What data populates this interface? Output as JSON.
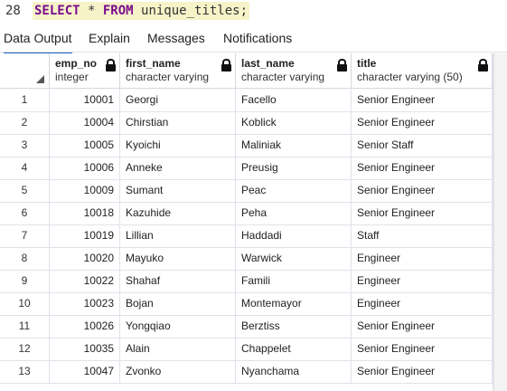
{
  "editor": {
    "line_number": "28",
    "kw_select": "SELECT",
    "star": " * ",
    "kw_from": "FROM",
    "rest": " unique_titles;"
  },
  "tabs": [
    {
      "label": "Data Output",
      "active": true
    },
    {
      "label": "Explain",
      "active": false
    },
    {
      "label": "Messages",
      "active": false
    },
    {
      "label": "Notifications",
      "active": false
    }
  ],
  "columns": [
    {
      "name": "emp_no",
      "type": "integer"
    },
    {
      "name": "first_name",
      "type": "character varying"
    },
    {
      "name": "last_name",
      "type": "character varying"
    },
    {
      "name": "title",
      "type": "character varying (50)"
    }
  ],
  "rows": [
    {
      "idx": "1",
      "emp_no": "10001",
      "first_name": "Georgi",
      "last_name": "Facello",
      "title": "Senior Engineer"
    },
    {
      "idx": "2",
      "emp_no": "10004",
      "first_name": "Chirstian",
      "last_name": "Koblick",
      "title": "Senior Engineer"
    },
    {
      "idx": "3",
      "emp_no": "10005",
      "first_name": "Kyoichi",
      "last_name": "Maliniak",
      "title": "Senior Staff"
    },
    {
      "idx": "4",
      "emp_no": "10006",
      "first_name": "Anneke",
      "last_name": "Preusig",
      "title": "Senior Engineer"
    },
    {
      "idx": "5",
      "emp_no": "10009",
      "first_name": "Sumant",
      "last_name": "Peac",
      "title": "Senior Engineer"
    },
    {
      "idx": "6",
      "emp_no": "10018",
      "first_name": "Kazuhide",
      "last_name": "Peha",
      "title": "Senior Engineer"
    },
    {
      "idx": "7",
      "emp_no": "10019",
      "first_name": "Lillian",
      "last_name": "Haddadi",
      "title": "Staff"
    },
    {
      "idx": "8",
      "emp_no": "10020",
      "first_name": "Mayuko",
      "last_name": "Warwick",
      "title": "Engineer"
    },
    {
      "idx": "9",
      "emp_no": "10022",
      "first_name": "Shahaf",
      "last_name": "Famili",
      "title": "Engineer"
    },
    {
      "idx": "10",
      "emp_no": "10023",
      "first_name": "Bojan",
      "last_name": "Montemayor",
      "title": "Engineer"
    },
    {
      "idx": "11",
      "emp_no": "10026",
      "first_name": "Yongqiao",
      "last_name": "Berztiss",
      "title": "Senior Engineer"
    },
    {
      "idx": "12",
      "emp_no": "10035",
      "first_name": "Alain",
      "last_name": "Chappelet",
      "title": "Senior Engineer"
    },
    {
      "idx": "13",
      "emp_no": "10047",
      "first_name": "Zvonko",
      "last_name": "Nyanchama",
      "title": "Senior Engineer"
    }
  ]
}
